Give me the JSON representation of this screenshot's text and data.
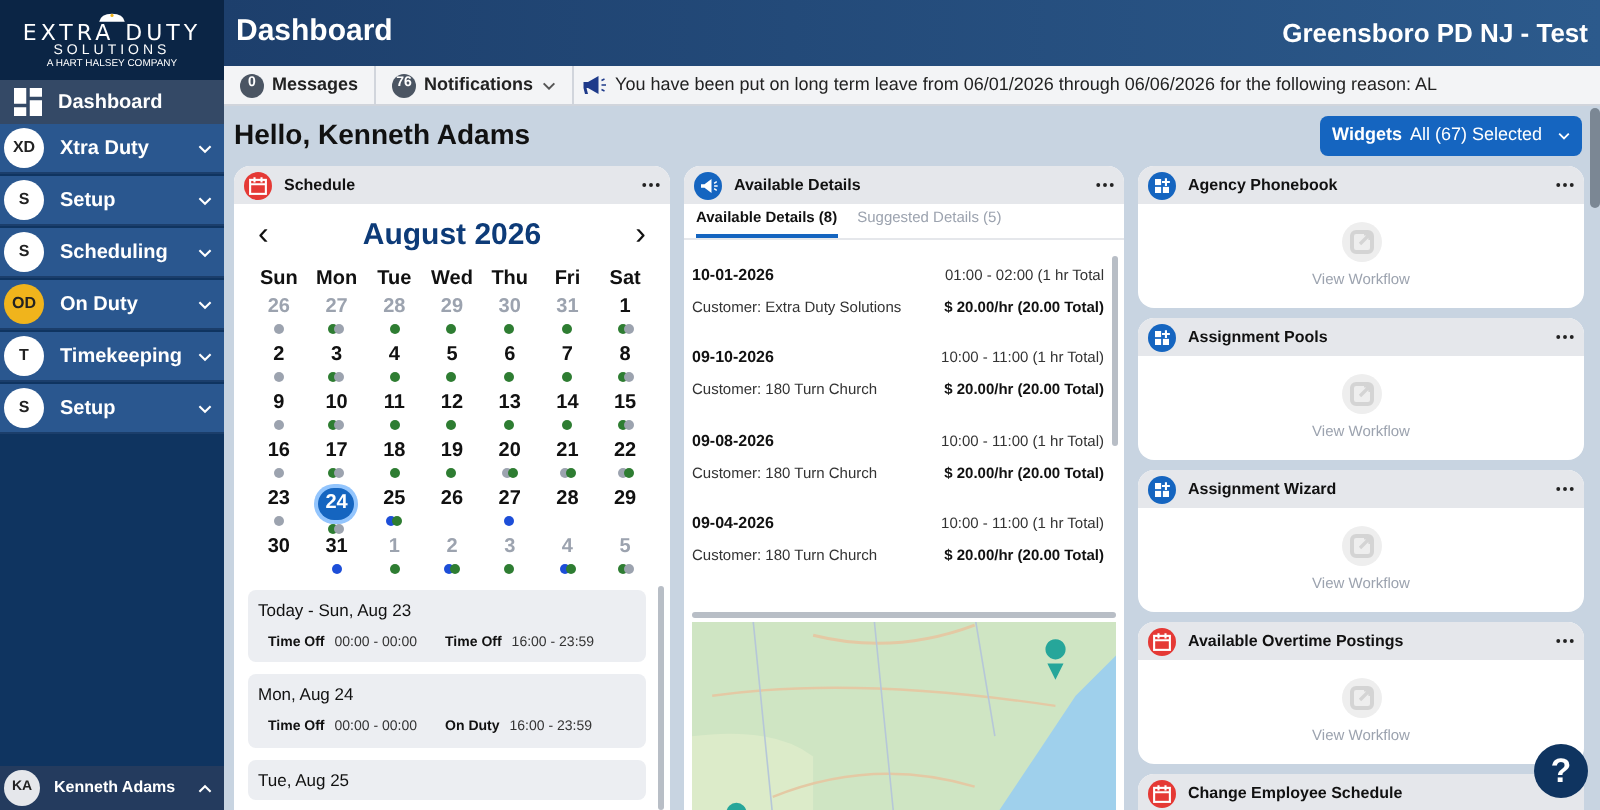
{
  "sidebar": {
    "logo": {
      "title": "EXTRA DUTY",
      "subtitle": "SOLUTIONS",
      "tagline": "A HART HALSEY COMPANY"
    },
    "items": [
      {
        "kind": "icon",
        "label": "Dashboard",
        "selected": true
      },
      {
        "kind": "badge",
        "badge": "XD",
        "label": "Xtra Duty",
        "color": "#ffffff",
        "selected": false,
        "expanded": false
      },
      {
        "kind": "badge",
        "badge": "S",
        "label": "Setup",
        "color": "#ffffff",
        "selected": false,
        "expanded": false
      },
      {
        "kind": "badge",
        "badge": "S",
        "label": "Scheduling",
        "color": "#ffffff",
        "selected": false,
        "expanded": false
      },
      {
        "kind": "badge",
        "badge": "OD",
        "label": "On Duty",
        "color": "#f0b41c",
        "selected": false,
        "expanded": false
      },
      {
        "kind": "badge",
        "badge": "T",
        "label": "Timekeeping",
        "color": "#ffffff",
        "selected": false,
        "expanded": false
      },
      {
        "kind": "badge",
        "badge": "S",
        "label": "Setup",
        "color": "#ffffff",
        "selected": false,
        "expanded": false
      }
    ],
    "user": {
      "initials": "KA",
      "name": "Kenneth Adams",
      "expanded": true
    }
  },
  "header": {
    "title": "Dashboard",
    "agency": "Greensboro PD NJ - Test"
  },
  "toolbar": {
    "messages": {
      "count": "0",
      "label": "Messages"
    },
    "notifications": {
      "count": "76",
      "label": "Notifications"
    },
    "announcement": "You have been put on long term leave from 06/01/2026 through 06/06/2026 for the following reason: AL"
  },
  "greeting": "Hello, Kenneth Adams",
  "widgets_button": {
    "label": "Widgets",
    "value": "All (67) Selected"
  },
  "schedule": {
    "title": "Schedule",
    "month": "August 2026",
    "prev": "‹",
    "next": "›",
    "weekdays": [
      "Sun",
      "Mon",
      "Tue",
      "Wed",
      "Thu",
      "Fri",
      "Sat"
    ],
    "days": [
      {
        "day": "26",
        "outside": true,
        "selected": false,
        "dots": [
          {
            "color": "#9ca3af"
          }
        ]
      },
      {
        "day": "27",
        "outside": true,
        "selected": false,
        "dots": [
          {
            "color": "#2e7d32"
          },
          {
            "color": "#9ca3af"
          }
        ]
      },
      {
        "day": "28",
        "outside": true,
        "selected": false,
        "dots": [
          {
            "color": "#2e7d32"
          }
        ]
      },
      {
        "day": "29",
        "outside": true,
        "selected": false,
        "dots": [
          {
            "color": "#2e7d32"
          }
        ]
      },
      {
        "day": "30",
        "outside": true,
        "selected": false,
        "dots": [
          {
            "color": "#2e7d32"
          }
        ]
      },
      {
        "day": "31",
        "outside": true,
        "selected": false,
        "dots": [
          {
            "color": "#2e7d32"
          }
        ]
      },
      {
        "day": "1",
        "outside": false,
        "selected": false,
        "dots": [
          {
            "color": "#2e7d32"
          },
          {
            "color": "#9ca3af"
          }
        ]
      },
      {
        "day": "2",
        "outside": false,
        "selected": false,
        "dots": [
          {
            "color": "#9ca3af"
          }
        ]
      },
      {
        "day": "3",
        "outside": false,
        "selected": false,
        "dots": [
          {
            "color": "#2e7d32"
          },
          {
            "color": "#9ca3af"
          }
        ]
      },
      {
        "day": "4",
        "outside": false,
        "selected": false,
        "dots": [
          {
            "color": "#2e7d32"
          }
        ]
      },
      {
        "day": "5",
        "outside": false,
        "selected": false,
        "dots": [
          {
            "color": "#2e7d32"
          }
        ]
      },
      {
        "day": "6",
        "outside": false,
        "selected": false,
        "dots": [
          {
            "color": "#2e7d32"
          }
        ]
      },
      {
        "day": "7",
        "outside": false,
        "selected": false,
        "dots": [
          {
            "color": "#2e7d32"
          }
        ]
      },
      {
        "day": "8",
        "outside": false,
        "selected": false,
        "dots": [
          {
            "color": "#2e7d32"
          },
          {
            "color": "#9ca3af"
          }
        ]
      },
      {
        "day": "9",
        "outside": false,
        "selected": false,
        "dots": [
          {
            "color": "#9ca3af"
          }
        ]
      },
      {
        "day": "10",
        "outside": false,
        "selected": false,
        "dots": [
          {
            "color": "#2e7d32"
          },
          {
            "color": "#9ca3af"
          }
        ]
      },
      {
        "day": "11",
        "outside": false,
        "selected": false,
        "dots": [
          {
            "color": "#2e7d32"
          }
        ]
      },
      {
        "day": "12",
        "outside": false,
        "selected": false,
        "dots": [
          {
            "color": "#2e7d32"
          }
        ]
      },
      {
        "day": "13",
        "outside": false,
        "selected": false,
        "dots": [
          {
            "color": "#2e7d32"
          }
        ]
      },
      {
        "day": "14",
        "outside": false,
        "selected": false,
        "dots": [
          {
            "color": "#2e7d32"
          }
        ]
      },
      {
        "day": "15",
        "outside": false,
        "selected": false,
        "dots": [
          {
            "color": "#2e7d32"
          },
          {
            "color": "#9ca3af"
          }
        ]
      },
      {
        "day": "16",
        "outside": false,
        "selected": false,
        "dots": [
          {
            "color": "#9ca3af"
          }
        ]
      },
      {
        "day": "17",
        "outside": false,
        "selected": false,
        "dots": [
          {
            "color": "#2e7d32"
          },
          {
            "color": "#9ca3af"
          }
        ]
      },
      {
        "day": "18",
        "outside": false,
        "selected": false,
        "dots": [
          {
            "color": "#2e7d32"
          }
        ]
      },
      {
        "day": "19",
        "outside": false,
        "selected": false,
        "dots": [
          {
            "color": "#2e7d32"
          }
        ]
      },
      {
        "day": "20",
        "outside": false,
        "selected": false,
        "dots": [
          {
            "color": "#9ca3af"
          },
          {
            "color": "#2e7d32"
          }
        ]
      },
      {
        "day": "21",
        "outside": false,
        "selected": false,
        "dots": [
          {
            "color": "#9ca3af"
          },
          {
            "color": "#2e7d32"
          }
        ]
      },
      {
        "day": "22",
        "outside": false,
        "selected": false,
        "dots": [
          {
            "color": "#9ca3af"
          },
          {
            "color": "#2e7d32"
          }
        ]
      },
      {
        "day": "23",
        "outside": false,
        "selected": false,
        "dots": [
          {
            "color": "#9ca3af"
          }
        ]
      },
      {
        "day": "24",
        "outside": false,
        "selected": true,
        "dots": [
          {
            "color": "#2e7d32"
          },
          {
            "color": "#9ca3af"
          }
        ]
      },
      {
        "day": "25",
        "outside": false,
        "selected": false,
        "dots": [
          {
            "color": "#1d4ed8"
          },
          {
            "color": "#2e7d32"
          }
        ]
      },
      {
        "day": "26",
        "outside": false,
        "selected": false
      },
      {
        "day": "27",
        "outside": false,
        "selected": false,
        "dots": [
          {
            "color": "#1d4ed8"
          }
        ]
      },
      {
        "day": "28",
        "outside": false,
        "selected": false
      },
      {
        "day": "29",
        "outside": false,
        "selected": false
      },
      {
        "day": "30",
        "outside": false,
        "selected": false
      },
      {
        "day": "31",
        "outside": false,
        "selected": false,
        "dots": [
          {
            "color": "#1d4ed8"
          }
        ]
      },
      {
        "day": "1",
        "outside": true,
        "selected": false,
        "dots": [
          {
            "color": "#2e7d32"
          }
        ]
      },
      {
        "day": "2",
        "outside": true,
        "selected": false,
        "dots": [
          {
            "color": "#1d4ed8"
          },
          {
            "color": "#2e7d32"
          }
        ]
      },
      {
        "day": "3",
        "outside": true,
        "selected": false,
        "dots": [
          {
            "color": "#2e7d32"
          }
        ]
      },
      {
        "day": "4",
        "outside": true,
        "selected": false,
        "dots": [
          {
            "color": "#1d4ed8"
          },
          {
            "color": "#2e7d32"
          }
        ]
      },
      {
        "day": "5",
        "outside": true,
        "selected": false,
        "dots": [
          {
            "color": "#2e7d32"
          },
          {
            "color": "#9ca3af"
          }
        ]
      }
    ],
    "agenda": [
      {
        "date": "Today - Sun, Aug 23",
        "entries": [
          {
            "type": "Time Off",
            "time": "00:00 - 00:00"
          },
          {
            "type": "Time Off",
            "time": "16:00 - 23:59"
          }
        ]
      },
      {
        "date": "Mon, Aug 24",
        "entries": [
          {
            "type": "Time Off",
            "time": "00:00 - 00:00"
          },
          {
            "type": "On Duty",
            "time": "16:00 - 23:59"
          }
        ]
      },
      {
        "date": "Tue, Aug 25"
      }
    ]
  },
  "details": {
    "title": "Available Details",
    "tabs": [
      {
        "label": "Available Details (8)",
        "selected": true
      },
      {
        "label": "Suggested Details (5)",
        "selected": false
      }
    ],
    "items": [
      {
        "date": "10-01-2026",
        "time": "01:00 - 02:00 (1 hr Total",
        "customer": "Customer: Extra Duty Solutions",
        "rate": "$ 20.00/hr (20.00 Total)"
      },
      {
        "date": "09-10-2026",
        "time": "10:00 - 11:00 (1 hr Total)",
        "customer": "Customer: 180 Turn Church",
        "rate": "$ 20.00/hr (20.00 Total)"
      },
      {
        "date": "09-08-2026",
        "time": "10:00 - 11:00 (1 hr Total)",
        "customer": "Customer: 180 Turn Church",
        "rate": "$ 20.00/hr (20.00 Total)"
      },
      {
        "date": "09-04-2026",
        "time": "10:00 - 11:00 (1 hr Total)",
        "customer": "Customer: 180 Turn Church",
        "rate": "$ 20.00/hr (20.00 Total)"
      }
    ]
  },
  "widgets": [
    {
      "title": "Agency Phonebook",
      "kind": "apps",
      "link": "View Workflow"
    },
    {
      "title": "Assignment Pools",
      "kind": "apps",
      "link": "View Workflow"
    },
    {
      "title": "Assignment Wizard",
      "kind": "apps",
      "link": "View Workflow"
    },
    {
      "title": "Available Overtime Postings",
      "kind": "calendar",
      "link": "View Workflow"
    },
    {
      "title": "Change Employee Schedule",
      "kind": "calendar"
    }
  ],
  "help": "?"
}
